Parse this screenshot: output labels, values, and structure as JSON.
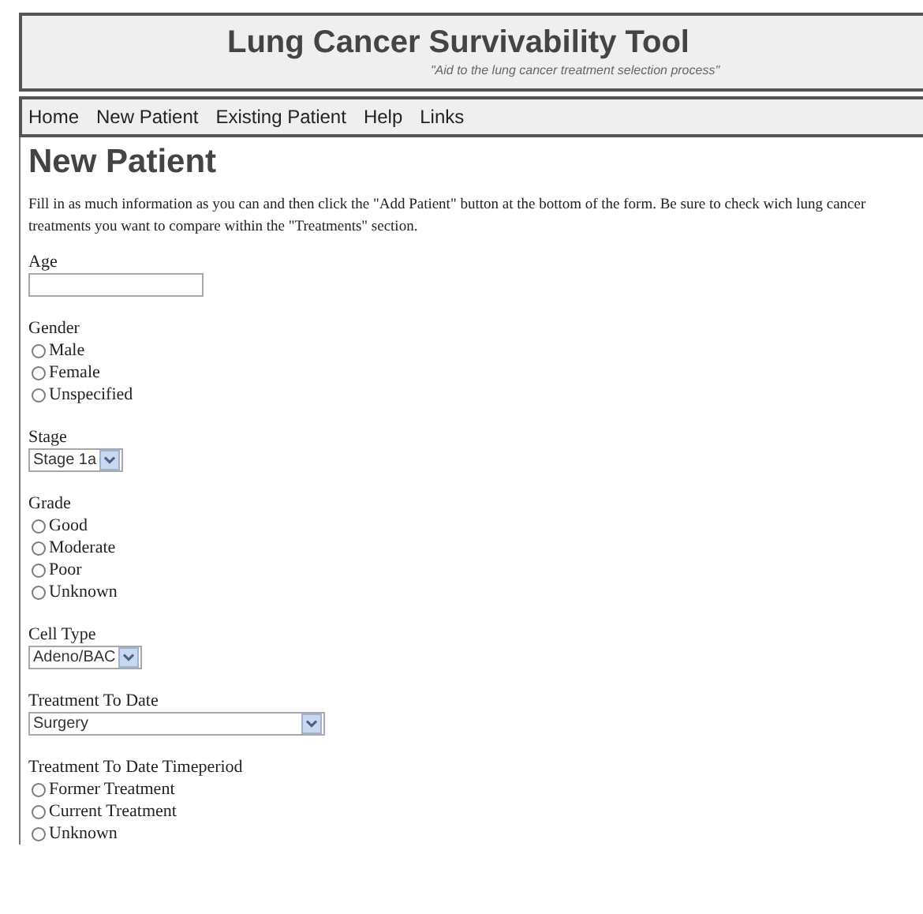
{
  "header": {
    "title": "Lung Cancer Survivability Tool",
    "subtitle": "\"Aid to the lung cancer treatment selection process\""
  },
  "nav": [
    {
      "label": "Home"
    },
    {
      "label": "New Patient"
    },
    {
      "label": "Existing Patient"
    },
    {
      "label": "Help"
    },
    {
      "label": "Links"
    }
  ],
  "page_title": "New Patient",
  "intro": "Fill in as much information as you can and then click the \"Add Patient\" button at the bottom of the form.  Be sure to check wich lung cancer treatments you want to compare within the \"Treatments\" section.",
  "fields": [
    {
      "kind": "text",
      "label": "Age"
    },
    {
      "kind": "radio",
      "label": "Gender",
      "options": [
        {
          "label": "Male",
          "selected": false
        },
        {
          "label": "Female",
          "selected": false
        },
        {
          "label": "Unspecified",
          "selected": false
        }
      ]
    },
    {
      "kind": "select",
      "label": "Stage",
      "value": "Stage 1a"
    },
    {
      "kind": "radio",
      "label": "Grade",
      "options": [
        {
          "label": "Good",
          "selected": false
        },
        {
          "label": "Moderate",
          "selected": false
        },
        {
          "label": "Poor",
          "selected": false
        },
        {
          "label": "Unknown",
          "selected": false
        }
      ]
    },
    {
      "kind": "select",
      "label": "Cell Type",
      "value": "Adeno/BAC"
    },
    {
      "kind": "wideselect",
      "label": "Treatment To Date",
      "value": "Surgery"
    },
    {
      "kind": "radio",
      "label": "Treatment To Date Timeperiod",
      "options": [
        {
          "label": "Former Treatment",
          "selected": false
        },
        {
          "label": "Current Treatment",
          "selected": false
        },
        {
          "label": "Unknown",
          "selected": false
        }
      ]
    }
  ]
}
